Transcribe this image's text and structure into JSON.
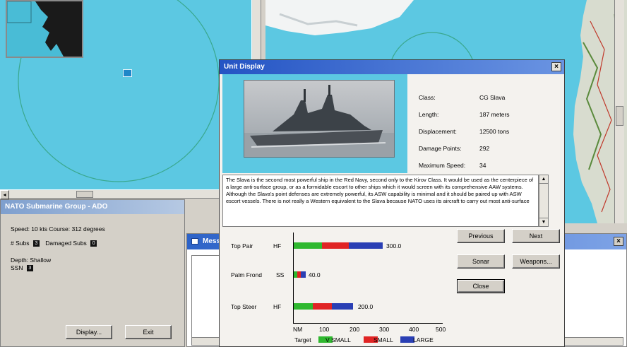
{
  "nato_panel": {
    "title": "NATO Submarine Group - ADO",
    "speed_line": "Speed: 10 kts   Course: 312 degrees",
    "subs_label": "# Subs",
    "subs_count": "3",
    "damaged_label": "Damaged Subs",
    "damaged_count": "0",
    "depth_line": "Depth: Shallow",
    "ssn_label": "SSN",
    "ssn_count": "3",
    "display_button": "Display...",
    "exit_button": "Exit"
  },
  "message_window": {
    "title": "Messages"
  },
  "unit_display": {
    "title": "Unit Display",
    "close_glyph": "×",
    "stats": [
      {
        "label": "Class:",
        "value": "CG  Slava"
      },
      {
        "label": "Length:",
        "value": "187 meters"
      },
      {
        "label": "Displacement:",
        "value": "12500 tons"
      },
      {
        "label": "Damage Points:",
        "value": "292"
      },
      {
        "label": "Maximum Speed:",
        "value": "34"
      }
    ],
    "description": "The Slava is the second most powerful ship in the Red Navy, second only to the Kirov Class.  It would be used as the centerpiece of a large anti-surface group, or as a formidable escort to other ships which it would screen with its comprehensive AAW systems.  Although the Slava's point defenses are extremely powerful, its ASW capability is minimal and it should be paired up with ASW escort vessels.  There is not really a Western equivalent to the Slava because NATO uses its aircraft to carry out most anti-surface",
    "buttons": {
      "previous": "Previous",
      "next": "Next",
      "sonar": "Sonar",
      "weapons": "Weapons...",
      "close": "Close"
    },
    "sensors": [
      {
        "name": "Top Pair",
        "band": "HF",
        "value_label": "300.0",
        "segments": [
          95,
          90,
          115
        ]
      },
      {
        "name": "Palm Frond",
        "band": "SS",
        "value_label": "40.0",
        "segments": [
          12,
          12,
          16
        ]
      },
      {
        "name": "Top Steer",
        "band": "HF",
        "value_label": "200.0",
        "segments": [
          65,
          63,
          72
        ]
      }
    ],
    "axis": {
      "unit": "NM",
      "ticks": [
        "100",
        "200",
        "300",
        "400",
        "500"
      ],
      "max": 500
    },
    "legend": {
      "title": "Target",
      "items": [
        {
          "label": "V SMALL",
          "color": "#2fb82f"
        },
        {
          "label": "SMALL",
          "color": "#e02424"
        },
        {
          "label": "LARGE",
          "color": "#2a3fb4"
        }
      ]
    }
  }
}
